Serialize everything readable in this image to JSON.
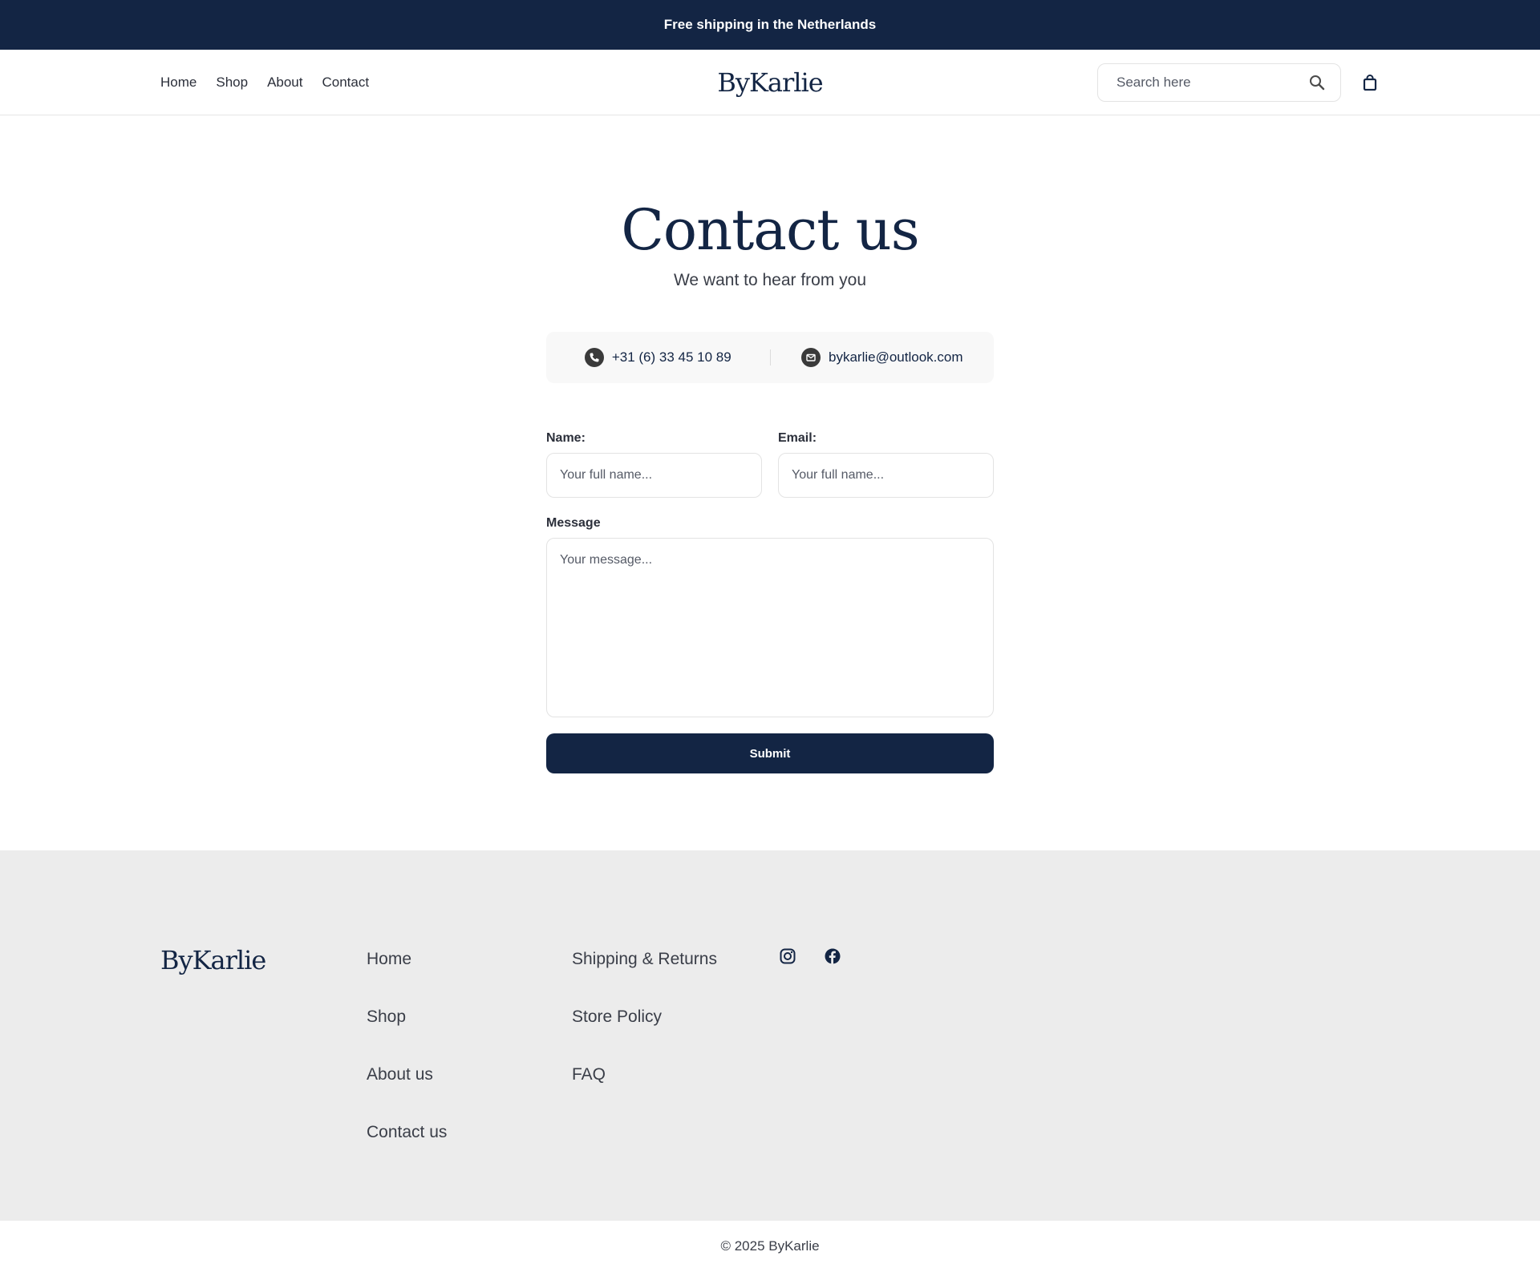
{
  "announcement": {
    "text": "Free shipping in the Netherlands"
  },
  "header": {
    "nav": [
      "Home",
      "Shop",
      "About",
      "Contact"
    ],
    "logo": "ByKarlie",
    "search": {
      "placeholder": "Search here",
      "value": ""
    },
    "icons": {
      "search": "search-icon",
      "cart": "shopping-bag-icon"
    }
  },
  "main": {
    "title": "Contact us",
    "subtitle": "We want to hear from you",
    "contact": {
      "phone": "+31 (6) 33 45 10 89",
      "email": "bykarlie@outlook.com",
      "phone_icon": "phone-icon",
      "email_icon": "mail-icon"
    },
    "form": {
      "name_label": "Name:",
      "name_placeholder": "Your full name...",
      "email_label": "Email:",
      "email_placeholder": "Your full name...",
      "message_label": "Message",
      "message_placeholder": "Your message...",
      "submit_label": "Submit"
    }
  },
  "footer": {
    "logo": "ByKarlie",
    "col1": [
      "Home",
      "Shop",
      "About us",
      "Contact us"
    ],
    "col2": [
      "Shipping & Returns",
      "Store Policy",
      "FAQ"
    ],
    "social": [
      "instagram-icon",
      "facebook-icon"
    ],
    "copyright": "© 2025 ByKarlie"
  },
  "colors": {
    "brand": "#132544",
    "footer_bg": "#ececec",
    "text": "#2b2f3a"
  }
}
